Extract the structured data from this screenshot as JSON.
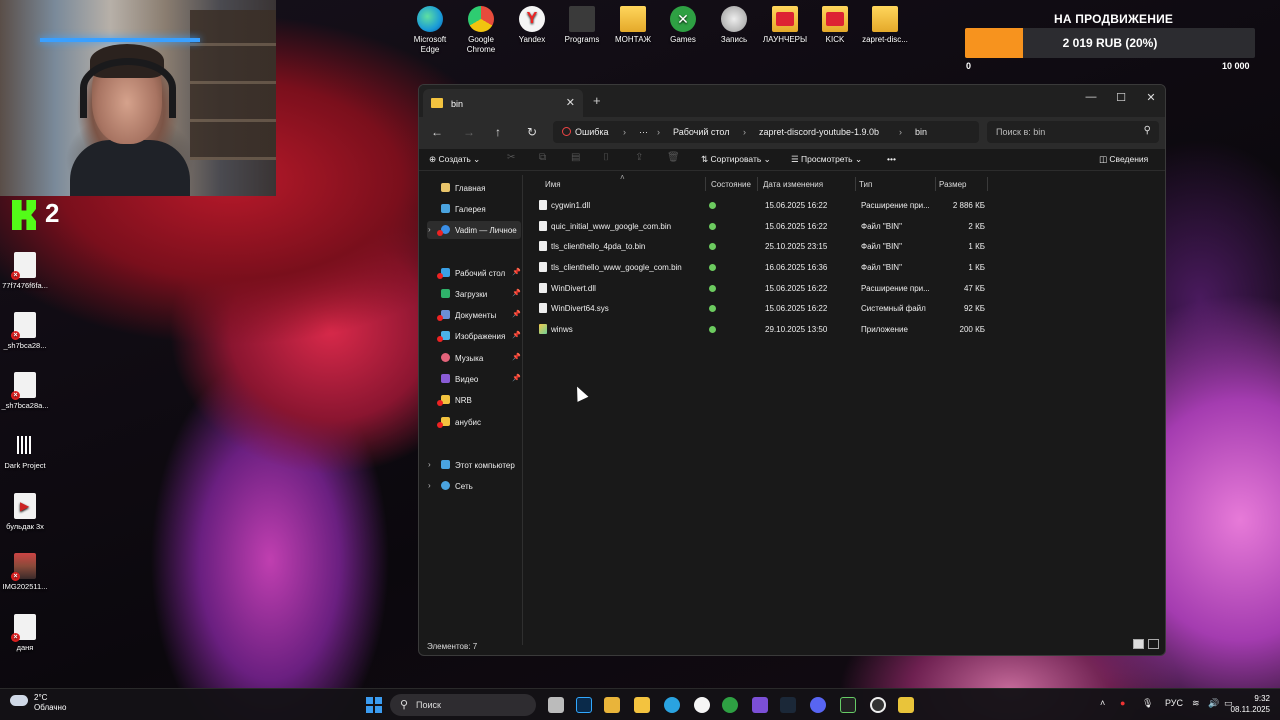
{
  "donation": {
    "title": "НА ПРОДВИЖЕНИЕ",
    "progress_text": "2 019 RUB (20%)",
    "progress_fraction": 0.2,
    "min": "0",
    "max": "10 000"
  },
  "stream_badge": {
    "count": "2"
  },
  "top_shortcuts": [
    {
      "label": "Microsoft Edge",
      "icon": "edge-icon",
      "color": "#1a9bd7"
    },
    {
      "label": "Google Chrome",
      "icon": "chrome-icon",
      "color": "#e74c3c"
    },
    {
      "label": "Yandex",
      "icon": "yandex-icon",
      "color": "#f5f5f5"
    },
    {
      "label": "Programs",
      "icon": "programs-folder-icon",
      "color": "#444"
    },
    {
      "label": "МОНТАЖ",
      "icon": "folder-icon",
      "color": "#f3c33f"
    },
    {
      "label": "Games",
      "icon": "xbox-icon",
      "color": "#2ea043"
    },
    {
      "label": "Запись",
      "icon": "recording-icon",
      "color": "#c9c9c9"
    },
    {
      "label": "ЛАУНЧЕРЫ",
      "icon": "folder-icon",
      "color": "#f3c33f"
    },
    {
      "label": "KICK",
      "icon": "folder-icon",
      "color": "#f3c33f"
    },
    {
      "label": "zapret-disc...",
      "icon": "folder-icon",
      "color": "#f3c33f"
    }
  ],
  "desktop_icons": [
    {
      "label": "77f7476f6fa..."
    },
    {
      "label": "_sh7bca28..."
    },
    {
      "label": "_sh7bca28a..."
    },
    {
      "label": "Dark Project"
    },
    {
      "label": "бульдак 3х"
    },
    {
      "label": "IMG202511..."
    },
    {
      "label": "даня"
    }
  ],
  "explorer": {
    "tab_title": "bin",
    "breadcrumb": {
      "error": "Ошибка",
      "ellipsis": "···",
      "items": [
        "Рабочий стол",
        "zapret-discord-youtube-1.9.0b",
        "bin"
      ]
    },
    "search_placeholder": "Поиск в: bin",
    "toolbar": {
      "new": "Создать",
      "sort": "Сортировать",
      "view": "Просмотреть",
      "more": "•••",
      "details": "Сведения"
    },
    "sidebar": [
      {
        "label": "Главная",
        "icon": "home-icon",
        "color": "#e9c46a"
      },
      {
        "label": "Галерея",
        "icon": "gallery-icon",
        "color": "#4aa3df"
      },
      {
        "label": "Vadim — Личное",
        "icon": "onedrive-icon",
        "color": "#3a8ee6"
      },
      {
        "label": "Рабочий стол",
        "icon": "desktop-icon",
        "color": "#3aa0e6"
      },
      {
        "label": "Загрузки",
        "icon": "downloads-icon",
        "color": "#2fb26a"
      },
      {
        "label": "Документы",
        "icon": "documents-icon",
        "color": "#6b8fd6"
      },
      {
        "label": "Изображения",
        "icon": "pictures-icon",
        "color": "#4ab0e6"
      },
      {
        "label": "Музыка",
        "icon": "music-icon",
        "color": "#e3637a"
      },
      {
        "label": "Видео",
        "icon": "videos-icon",
        "color": "#8a5cd6"
      },
      {
        "label": "NRB",
        "icon": "folder-icon",
        "color": "#f3c33f"
      },
      {
        "label": "анубис",
        "icon": "folder-icon",
        "color": "#f3c33f"
      },
      {
        "label": "Этот компьютер",
        "icon": "this-pc-icon",
        "color": "#4aa3df"
      },
      {
        "label": "Сеть",
        "icon": "network-icon",
        "color": "#4aa3df"
      }
    ],
    "columns": [
      "Имя",
      "Состояние",
      "Дата изменения",
      "Тип",
      "Размер"
    ],
    "files": [
      {
        "name": "cygwin1.dll",
        "date": "15.06.2025 16:22",
        "type": "Расширение при...",
        "size": "2 886 КБ"
      },
      {
        "name": "quic_initial_www_google_com.bin",
        "date": "15.06.2025 16:22",
        "type": "Файл \"BIN\"",
        "size": "2 КБ"
      },
      {
        "name": "tls_clienthello_4pda_to.bin",
        "date": "25.10.2025 23:15",
        "type": "Файл \"BIN\"",
        "size": "1 КБ"
      },
      {
        "name": "tls_clienthello_www_google_com.bin",
        "date": "16.06.2025 16:36",
        "type": "Файл \"BIN\"",
        "size": "1 КБ"
      },
      {
        "name": "WinDivert.dll",
        "date": "15.06.2025 16:22",
        "type": "Расширение при...",
        "size": "47 КБ"
      },
      {
        "name": "WinDivert64.sys",
        "date": "15.06.2025 16:22",
        "type": "Системный файл",
        "size": "92 КБ"
      },
      {
        "name": "winws",
        "date": "29.10.2025 13:50",
        "type": "Приложение",
        "size": "200 КБ"
      }
    ],
    "status": "Элементов: 7"
  },
  "taskbar": {
    "weather_temp": "2°C",
    "weather_desc": "Облачно",
    "search_label": "Поиск",
    "lang": "РУС",
    "time": "9:32",
    "date": "08.11.2025"
  }
}
